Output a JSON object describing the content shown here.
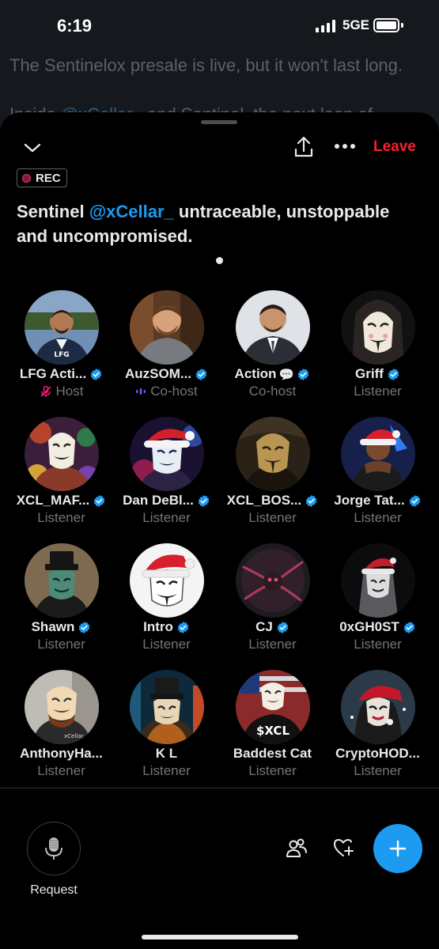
{
  "status_bar": {
    "time": "6:19",
    "network": "5GE"
  },
  "background_tweet": {
    "line1": "The Sentinelox presale is live, but it won't last long.",
    "line2_prefix": "Inside ",
    "line2_mention": "@xCellar_",
    "line2_suffix": " and Sentinel, the next leap of"
  },
  "space": {
    "leave_label": "Leave",
    "rec_label": "REC",
    "title_prefix": "Sentinel ",
    "title_mention": "@xCellar_",
    "title_suffix": " untraceable, unstoppable and uncompromised."
  },
  "participants": [
    {
      "name": "LFG Acti...",
      "role": "Host",
      "verified": true,
      "role_icon": "mic-off-icon",
      "avatar": "man-blue-suit"
    },
    {
      "name": "AuzSOM...",
      "role": "Co-host",
      "verified": true,
      "role_icon": "speaking-bars-icon",
      "avatar": "man-brown-bg"
    },
    {
      "name": "Action",
      "role": "Co-host",
      "verified": true,
      "name_icon": "speech-bubble-icon",
      "avatar": "man-suit-white"
    },
    {
      "name": "Griff",
      "role": "Listener",
      "verified": true,
      "avatar": "mask-hood"
    },
    {
      "name": "XCL_MAF...",
      "role": "Listener",
      "verified": true,
      "avatar": "mask-colorful"
    },
    {
      "name": "Dan DeBl...",
      "role": "Listener",
      "verified": true,
      "avatar": "mask-santa-hat"
    },
    {
      "name": "XCL_BOS...",
      "role": "Listener",
      "verified": true,
      "avatar": "mask-gold"
    },
    {
      "name": "Jorge Tat...",
      "role": "Listener",
      "verified": true,
      "avatar": "man-santa-hat"
    },
    {
      "name": "Shawn",
      "role": "Listener",
      "verified": true,
      "avatar": "mask-top-hat"
    },
    {
      "name": "Intro",
      "role": "Listener",
      "verified": true,
      "avatar": "mask-santa-white"
    },
    {
      "name": "CJ",
      "role": "Listener",
      "verified": true,
      "avatar": "creature-dark"
    },
    {
      "name": "0xGH0ST",
      "role": "Listener",
      "verified": true,
      "avatar": "ghost-santa"
    },
    {
      "name": "AnthonyHa...",
      "role": "Listener",
      "verified": false,
      "avatar": "mask-xcellar-shirt"
    },
    {
      "name": "K L",
      "role": "Listener",
      "verified": false,
      "avatar": "mask-top-hat-city"
    },
    {
      "name": "Baddest Cat",
      "role": "Listener",
      "verified": false,
      "avatar": "mask-xcl-shirt"
    },
    {
      "name": "CryptoHOD...",
      "role": "Listener",
      "verified": false,
      "avatar": "woman-red-hat"
    }
  ],
  "bottom_bar": {
    "request_label": "Request"
  },
  "colors": {
    "accent": "#1d9bf0",
    "leave": "#f4212e",
    "muted": "#71767b",
    "host_icon": "#f91880",
    "cohost_icon": "#7856ff"
  }
}
